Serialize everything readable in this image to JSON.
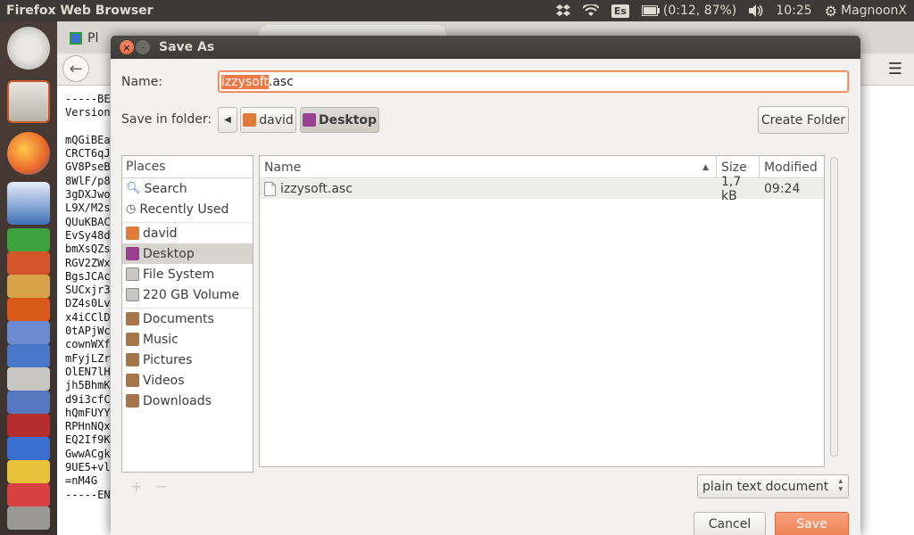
{
  "top_panel": {
    "app_title": "Firefox Web Browser",
    "keyboard_layout": "Es",
    "battery": "(0:12, 87%)",
    "clock": "10:25",
    "user": "MagnoonX"
  },
  "browser": {
    "tab1_label": "Pl",
    "page_lines": "-----BE\nVersion\n\nmQGiBEa\nCRCT6qJ\nGV8PseB\n8WlF/p8\n3gDXJwo\nL9X/M2s\nQUuKBAC\nEvSy48d\nbmXsQZs\nRGV2ZWx\nBgsJCAc\nSUCxjr3\nDZ4s0Lv\nx4iCClD\n0tAPjWc\ncownWXf\nmFyjLZr\nOlEN7lH\njh5BhmK\nd9i3cfC\nhQmFUYY\nRPHnNQx\nEQ2If9K\nGwwACgk\n9UE5+vl\n=nM4G\n-----EN"
  },
  "dialog": {
    "title": "Save As",
    "name_label": "Name:",
    "filename_selected": "izzysoft",
    "filename_ext": ".asc",
    "save_in_label": "Save in folder:",
    "path": [
      "david",
      "Desktop"
    ],
    "create_folder": "Create Folder",
    "places_header": "Places",
    "places": [
      {
        "label": "Search",
        "icon": "search-icon"
      },
      {
        "label": "Recently Used",
        "icon": "clock-icon"
      },
      {
        "label": "david",
        "icon": "home-folder-icon"
      },
      {
        "label": "Desktop",
        "icon": "desktop-icon"
      },
      {
        "label": "File System",
        "icon": "drive-icon"
      },
      {
        "label": "220 GB Volume",
        "icon": "drive-icon"
      },
      {
        "label": "Documents",
        "icon": "folder-icon"
      },
      {
        "label": "Music",
        "icon": "music-folder-icon"
      },
      {
        "label": "Pictures",
        "icon": "pictures-folder-icon"
      },
      {
        "label": "Videos",
        "icon": "videos-folder-icon"
      },
      {
        "label": "Downloads",
        "icon": "downloads-folder-icon"
      }
    ],
    "columns": {
      "name": "Name",
      "size": "Size",
      "modified": "Modified"
    },
    "files": [
      {
        "name": "izzysoft.asc",
        "size": "1,7 kB",
        "modified": "09:24"
      }
    ],
    "add_symbol": "+",
    "remove_symbol": "−",
    "filter": "plain text document",
    "cancel": "Cancel",
    "save": "Save"
  },
  "colors": {
    "accent": "#f07746",
    "panel": "#3b3a36",
    "selected_row": "#d7d4cf"
  }
}
